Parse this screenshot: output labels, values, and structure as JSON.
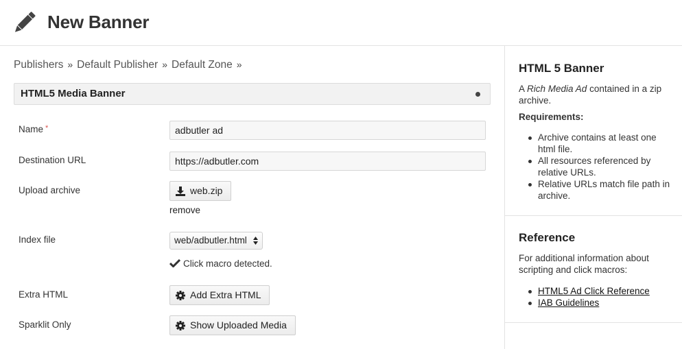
{
  "header": {
    "title": "New Banner",
    "icon": "pencil-icon"
  },
  "breadcrumb": {
    "items": [
      "Publishers",
      "Default Publisher",
      "Default Zone"
    ],
    "separator": "»"
  },
  "panel": {
    "title": "HTML5 Media Banner"
  },
  "form": {
    "name": {
      "label": "Name",
      "required_mark": "*",
      "value": "adbutler ad"
    },
    "destination_url": {
      "label": "Destination URL",
      "value": "https://adbutler.com"
    },
    "upload_archive": {
      "label": "Upload archive",
      "file_button": "web.zip",
      "remove_label": "remove"
    },
    "index_file": {
      "label": "Index file",
      "selected": "web/adbutler.html",
      "detected_text": "Click macro detected."
    },
    "extra_html": {
      "label": "Extra HTML",
      "button": "Add Extra HTML"
    },
    "sparklit_only": {
      "label": "Sparklit Only",
      "button": "Show Uploaded Media"
    }
  },
  "sidebar": {
    "banner_info": {
      "title": "HTML 5 Banner",
      "desc_prefix": "A ",
      "desc_emphasis": "Rich Media Ad",
      "desc_suffix": " contained in a zip archive.",
      "requirements_title": "Requirements:",
      "requirements": [
        "Archive contains at least one html file.",
        "All resources referenced by relative URLs.",
        "Relative URLs match file path in archive."
      ]
    },
    "reference": {
      "title": "Reference",
      "text": "For additional information about scripting and click macros:",
      "links": [
        "HTML5 Ad Click Reference",
        "IAB Guidelines"
      ]
    }
  }
}
